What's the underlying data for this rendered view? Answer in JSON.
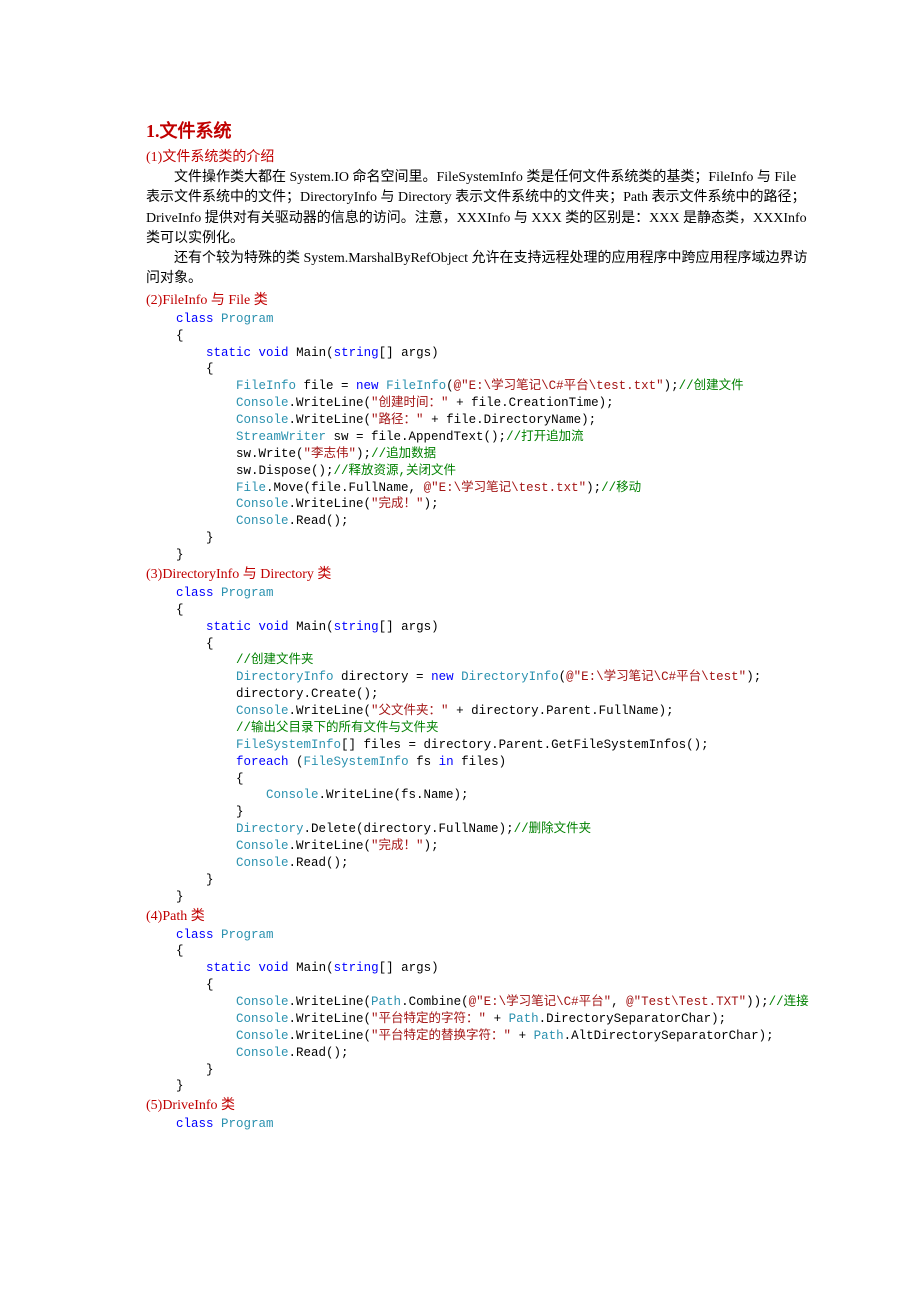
{
  "title": "1.文件系统",
  "s1": {
    "head": "(1)文件系统类的介绍",
    "p1": "文件操作类大都在 System.IO 命名空间里。FileSystemInfo 类是任何文件系统类的基类；FileInfo 与 File 表示文件系统中的文件；DirectoryInfo 与 Directory 表示文件系统中的文件夹；Path 表示文件系统中的路径；DriveInfo 提供对有关驱动器的信息的访问。注意，XXXInfo 与 XXX 类的区别是：XXX 是静态类，XXXInfo 类可以实例化。",
    "p2": "还有个较为特殊的类 System.MarshalByRefObject 允许在支持远程处理的应用程序中跨应用程序域边界访问对象。"
  },
  "s2": {
    "head": "(2)FileInfo 与 File 类",
    "c": {
      "l01a": "class",
      "l01b": " ",
      "l01c": "Program",
      "l02": "{",
      "l03a": "    ",
      "l03b": "static",
      "l03c": " ",
      "l03d": "void",
      "l03e": " Main(",
      "l03f": "string",
      "l03g": "[] args)",
      "l04": "    {",
      "l05a": "        ",
      "l05b": "FileInfo",
      "l05c": " file = ",
      "l05d": "new",
      "l05e": " ",
      "l05f": "FileInfo",
      "l05g": "(",
      "l05h": "@\"E:\\学习笔记\\C#平台\\test.txt\"",
      "l05i": ");",
      "l05j": "//创建文件",
      "l06a": "        ",
      "l06b": "Console",
      "l06c": ".WriteLine(",
      "l06d": "\"创建时间：\"",
      "l06e": " + file.CreationTime);",
      "l07a": "        ",
      "l07b": "Console",
      "l07c": ".WriteLine(",
      "l07d": "\"路径：\"",
      "l07e": " + file.DirectoryName);",
      "l08a": "        ",
      "l08b": "StreamWriter",
      "l08c": " sw = file.AppendText();",
      "l08d": "//打开追加流",
      "l09a": "        sw.Write(",
      "l09b": "\"李志伟\"",
      "l09c": ");",
      "l09d": "//追加数据",
      "l10a": "        sw.Dispose();",
      "l10b": "//释放资源,关闭文件",
      "l11a": "        ",
      "l11b": "File",
      "l11c": ".Move(file.FullName, ",
      "l11d": "@\"E:\\学习笔记\\test.txt\"",
      "l11e": ");",
      "l11f": "//移动",
      "l12a": "        ",
      "l12b": "Console",
      "l12c": ".WriteLine(",
      "l12d": "\"完成！\"",
      "l12e": ");",
      "l13a": "        ",
      "l13b": "Console",
      "l13c": ".Read();",
      "l14": "    }",
      "l15": "}"
    }
  },
  "s3": {
    "head": "(3)DirectoryInfo 与 Directory 类",
    "c": {
      "l01a": "class",
      "l01b": " ",
      "l01c": "Program",
      "l02": "{",
      "l03a": "    ",
      "l03b": "static",
      "l03c": " ",
      "l03d": "void",
      "l03e": " Main(",
      "l03f": "string",
      "l03g": "[] args)",
      "l04": "    {",
      "l05a": "        ",
      "l05b": "//创建文件夹",
      "l06a": "        ",
      "l06b": "DirectoryInfo",
      "l06c": " directory = ",
      "l06d": "new",
      "l06e": " ",
      "l06f": "DirectoryInfo",
      "l06g": "(",
      "l06h": "@\"E:\\学习笔记\\C#平台\\test\"",
      "l06i": ");",
      "l07": "        directory.Create();",
      "l08a": "        ",
      "l08b": "Console",
      "l08c": ".WriteLine(",
      "l08d": "\"父文件夹：\"",
      "l08e": " + directory.Parent.FullName);",
      "l09a": "        ",
      "l09b": "//输出父目录下的所有文件与文件夹",
      "l10a": "        ",
      "l10b": "FileSystemInfo",
      "l10c": "[] files = directory.Parent.GetFileSystemInfos();",
      "l11a": "        ",
      "l11b": "foreach",
      "l11c": " (",
      "l11d": "FileSystemInfo",
      "l11e": " fs ",
      "l11f": "in",
      "l11g": " files)",
      "l12": "        {",
      "l13a": "            ",
      "l13b": "Console",
      "l13c": ".WriteLine(fs.Name);",
      "l14": "        }",
      "l15a": "        ",
      "l15b": "Directory",
      "l15c": ".Delete(directory.FullName);",
      "l15d": "//删除文件夹",
      "l16a": "        ",
      "l16b": "Console",
      "l16c": ".WriteLine(",
      "l16d": "\"完成！\"",
      "l16e": ");",
      "l17a": "        ",
      "l17b": "Console",
      "l17c": ".Read();",
      "l18": "    }",
      "l19": "}"
    }
  },
  "s4": {
    "head": "(4)Path 类",
    "c": {
      "l01a": "class",
      "l01b": " ",
      "l01c": "Program",
      "l02": "{",
      "l03a": "    ",
      "l03b": "static",
      "l03c": " ",
      "l03d": "void",
      "l03e": " Main(",
      "l03f": "string",
      "l03g": "[] args)",
      "l04": "    {",
      "l05a": "        ",
      "l05b": "Console",
      "l05c": ".WriteLine(",
      "l05d": "Path",
      "l05e": ".Combine(",
      "l05f": "@\"E:\\学习笔记\\C#平台\"",
      "l05g": ", ",
      "l05h": "@\"Test\\Test.TXT\"",
      "l05i": "));",
      "l05j": "//连接",
      "l06a": "        ",
      "l06b": "Console",
      "l06c": ".WriteLine(",
      "l06d": "\"平台特定的字符：\"",
      "l06e": " + ",
      "l06f": "Path",
      "l06g": ".DirectorySeparatorChar);",
      "l07a": "        ",
      "l07b": "Console",
      "l07c": ".WriteLine(",
      "l07d": "\"平台特定的替换字符：\"",
      "l07e": " + ",
      "l07f": "Path",
      "l07g": ".AltDirectorySeparatorChar);",
      "l08a": "        ",
      "l08b": "Console",
      "l08c": ".Read();",
      "l09": "    }",
      "l10": "}"
    }
  },
  "s5": {
    "head": "(5)DriveInfo 类",
    "c": {
      "l01a": "class",
      "l01b": " ",
      "l01c": "Program"
    }
  }
}
